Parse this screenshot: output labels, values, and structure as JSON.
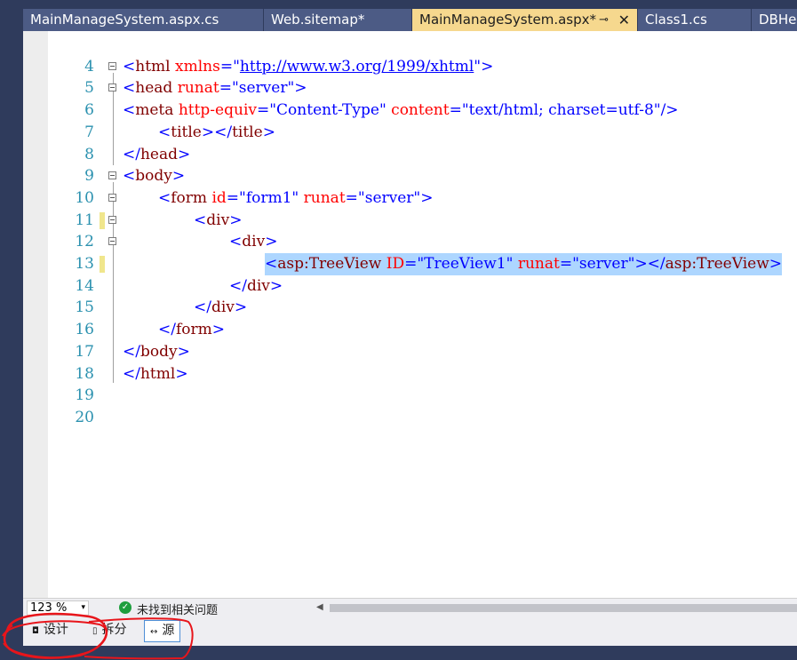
{
  "tabs": [
    {
      "label": "MainManageSystem.aspx.cs"
    },
    {
      "label": "Web.sitemap*"
    },
    {
      "label": "MainManageSystem.aspx*",
      "pin": "⊸",
      "close": "✕"
    },
    {
      "label": "Class1.cs"
    },
    {
      "label": "DBHel"
    }
  ],
  "editor": {
    "lines": [
      {
        "n": "4"
      },
      {
        "n": "5",
        "lt": "<",
        "tag": "html",
        "sp": " ",
        "a1": "xmlns",
        "eq": "=",
        "q1": "\"",
        "url": "http://www.w3.org/1999/xhtml",
        "q2": "\"",
        "gt": ">"
      },
      {
        "n": "6",
        "lt": "<",
        "tag": "head",
        "sp": " ",
        "a1": "runat",
        "eq": "=",
        "v1": "\"server\"",
        "gt": ">"
      },
      {
        "n": "7",
        "lt": "<",
        "tag": "meta",
        "sp": " ",
        "a1": "http-equiv",
        "eq": "=",
        "v1": "\"Content-Type\"",
        "sp2": " ",
        "a2": "content",
        "eq2": "=",
        "v2": "\"text/html; charset=utf-8\"",
        "gt": "/>"
      },
      {
        "n": "8",
        "lt": "<",
        "tag": "title",
        "gt": "></",
        "tag2": "title",
        "gt2": ">"
      },
      {
        "n": "9",
        "lt": "</",
        "tag": "head",
        "gt": ">"
      },
      {
        "n": "10",
        "lt": "<",
        "tag": "body",
        "gt": ">"
      },
      {
        "n": "11",
        "lt": "<",
        "tag": "form",
        "sp": " ",
        "a1": "id",
        "eq": "=",
        "v1": "\"form1\"",
        "sp2": " ",
        "a2": "runat",
        "eq2": "=",
        "v2": "\"server\"",
        "gt": ">"
      },
      {
        "n": "12",
        "lt": "<",
        "tag": "div",
        "gt": ">"
      },
      {
        "n": "13",
        "lt": "<",
        "tag": "div",
        "gt": ">"
      },
      {
        "n": "14",
        "lt": "<",
        "tag": "asp:TreeView",
        "sp": " ",
        "a1": "ID",
        "eq": "=",
        "v1": "\"TreeView1\"",
        "sp2": " ",
        "a2": "runat",
        "eq2": "=",
        "v2": "\"server\"",
        "gt": "></",
        "tag2": "asp:TreeView",
        "gt2": ">"
      },
      {
        "n": "15",
        "lt": "</",
        "tag": "div",
        "gt": ">"
      },
      {
        "n": "16",
        "lt": "</",
        "tag": "div",
        "gt": ">"
      },
      {
        "n": "17",
        "lt": "</",
        "tag": "form",
        "gt": ">"
      },
      {
        "n": "18",
        "lt": "</",
        "tag": "body",
        "gt": ">"
      },
      {
        "n": "19",
        "lt": "</",
        "tag": "html",
        "gt": ">"
      },
      {
        "n": "20"
      }
    ]
  },
  "statusbar": {
    "zoom": "123 %",
    "zoom_dropdown": "▾",
    "issues_icon": "✓",
    "issues_text": "未找到相关问题",
    "scroll_left": "◀"
  },
  "viewbar": {
    "design": {
      "icon": "◘",
      "label": "设计"
    },
    "split": {
      "icon": "▯",
      "label": "拆分"
    },
    "source": {
      "icon": "↔",
      "label": "源"
    }
  },
  "colors": {
    "frame": "#2f3b5c",
    "active_tab": "#f6d88e",
    "selection": "#add6ff",
    "line_number": "#2b91af",
    "annotation": "#e8151b"
  }
}
